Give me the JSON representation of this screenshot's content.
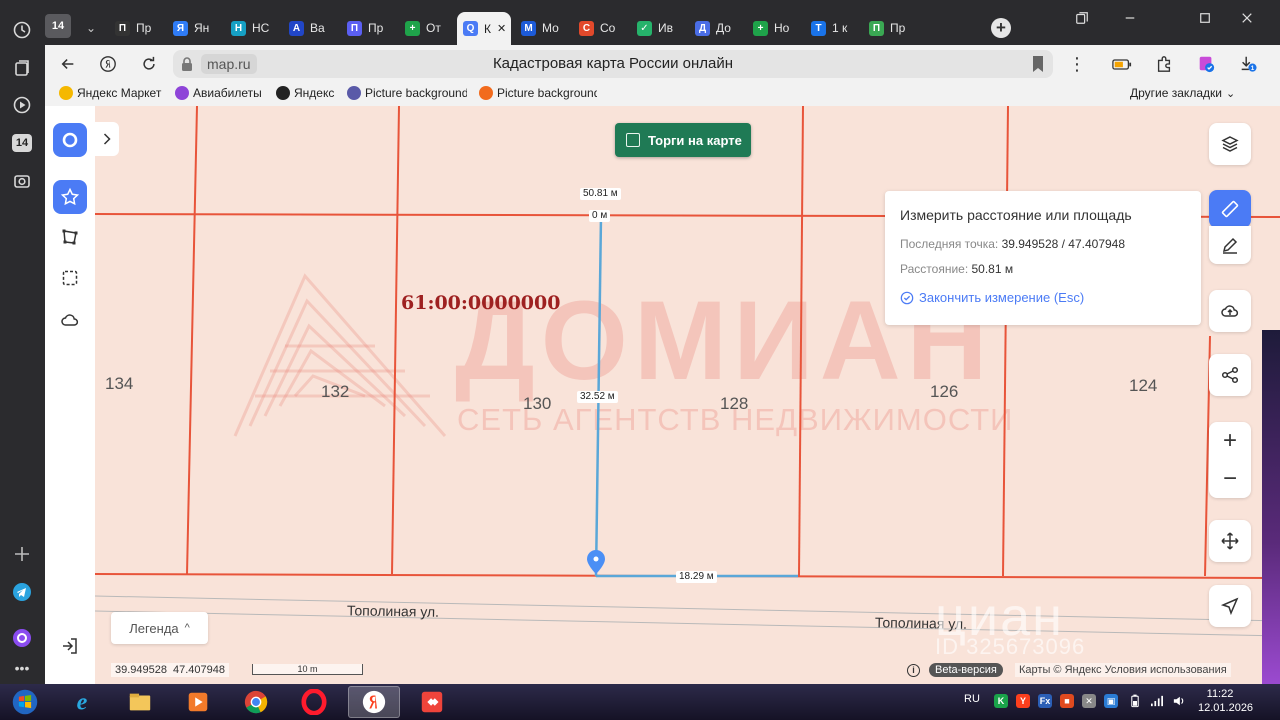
{
  "rail": {
    "items": [
      {
        "name": "history-icon"
      },
      {
        "name": "collections-icon"
      },
      {
        "name": "video-icon"
      },
      {
        "name": "calendar-badge",
        "label": "14"
      },
      {
        "name": "screenshot-icon"
      },
      {
        "name": "add-icon"
      },
      {
        "name": "telegram-icon"
      },
      {
        "name": "alice-icon"
      },
      {
        "name": "more-icon"
      }
    ]
  },
  "tabs": {
    "group_badge": "14",
    "items": [
      {
        "label": "Пр",
        "color": "#333333",
        "letter": "П"
      },
      {
        "label": "Ян",
        "color": "#2f7cf6",
        "letter": "Я"
      },
      {
        "label": "НС",
        "color": "#16a0c4",
        "letter": "Н"
      },
      {
        "label": "Ва",
        "color": "#2146c7",
        "letter": "A"
      },
      {
        "label": "Пр",
        "color": "#5b5ff2",
        "letter": "П"
      },
      {
        "label": "От",
        "color": "#1fa34a",
        "letter": "+"
      },
      {
        "label": "К",
        "color": "#4b7bf5",
        "letter": "Q",
        "active": true
      },
      {
        "label": "Мо",
        "color": "#1d5bd8",
        "letter": "M"
      },
      {
        "label": "Со",
        "color": "#e2492b",
        "letter": "С"
      },
      {
        "label": "Ив",
        "color": "#26b36b",
        "letter": "✓"
      },
      {
        "label": "До",
        "color": "#4a6de5",
        "letter": "Д"
      },
      {
        "label": "Но",
        "color": "#1fa34a",
        "letter": "+"
      },
      {
        "label": "1 к",
        "color": "#1a73e8",
        "letter": "T"
      },
      {
        "label": "Пр",
        "color": "#3aa853",
        "letter": "П"
      }
    ]
  },
  "address": {
    "domain": "map.ru",
    "title": "Кадастровая карта России онлайн"
  },
  "bookmarks": {
    "items": [
      {
        "label": "Яндекс Маркет",
        "color": "#f5b800"
      },
      {
        "label": "Авиабилеты",
        "color": "#8e44d8"
      },
      {
        "label": "Яндекс",
        "color": "#222222"
      },
      {
        "label": "Picture background",
        "color": "#5a5aa8"
      },
      {
        "label": "Picture background",
        "color": "#f26b1d"
      }
    ],
    "other": "Другие закладки"
  },
  "map": {
    "torgi_label": "Торги на карте",
    "cadastral_number": "61:00:0000000",
    "watermark": "ДОМИАН",
    "watermark_sub": "СЕТЬ АГЕНТСТВ НЕДВИЖИМОСТИ",
    "watermark_cian": "циан",
    "watermark_cian_id": "ID 325673096",
    "lots": [
      "134",
      "132",
      "130",
      "128",
      "126",
      "124"
    ],
    "streets": [
      "Тополиная ул.",
      "Тополиная ул."
    ],
    "distances": [
      "50.81 м",
      "0 м",
      "32.52 м",
      "18.29 м"
    ],
    "legend_label": "Легенда",
    "coords_lat": "39.949528",
    "coords_lon": "47.407948",
    "scale_label": "10 m",
    "beta_label": "Beta-версия",
    "copyright": "Карты © Яндекс   Условия использования"
  },
  "measure": {
    "title": "Измерить расстояние или площадь",
    "last_point_label": "Последняя точка:",
    "last_point_value": "39.949528 / 47.407948",
    "distance_label": "Расстояние:",
    "distance_value": "50.81 м",
    "finish_label": "Закончить измерение (Esc)"
  },
  "taskbar": {
    "lang": "RU",
    "time": "11:22",
    "date": "12.01.2026"
  },
  "colors": {
    "accent": "#4b7bf5",
    "parcel_line": "#e8543a",
    "map_bg": "#f9e3d9",
    "torgi_bg": "#1f7a55"
  }
}
